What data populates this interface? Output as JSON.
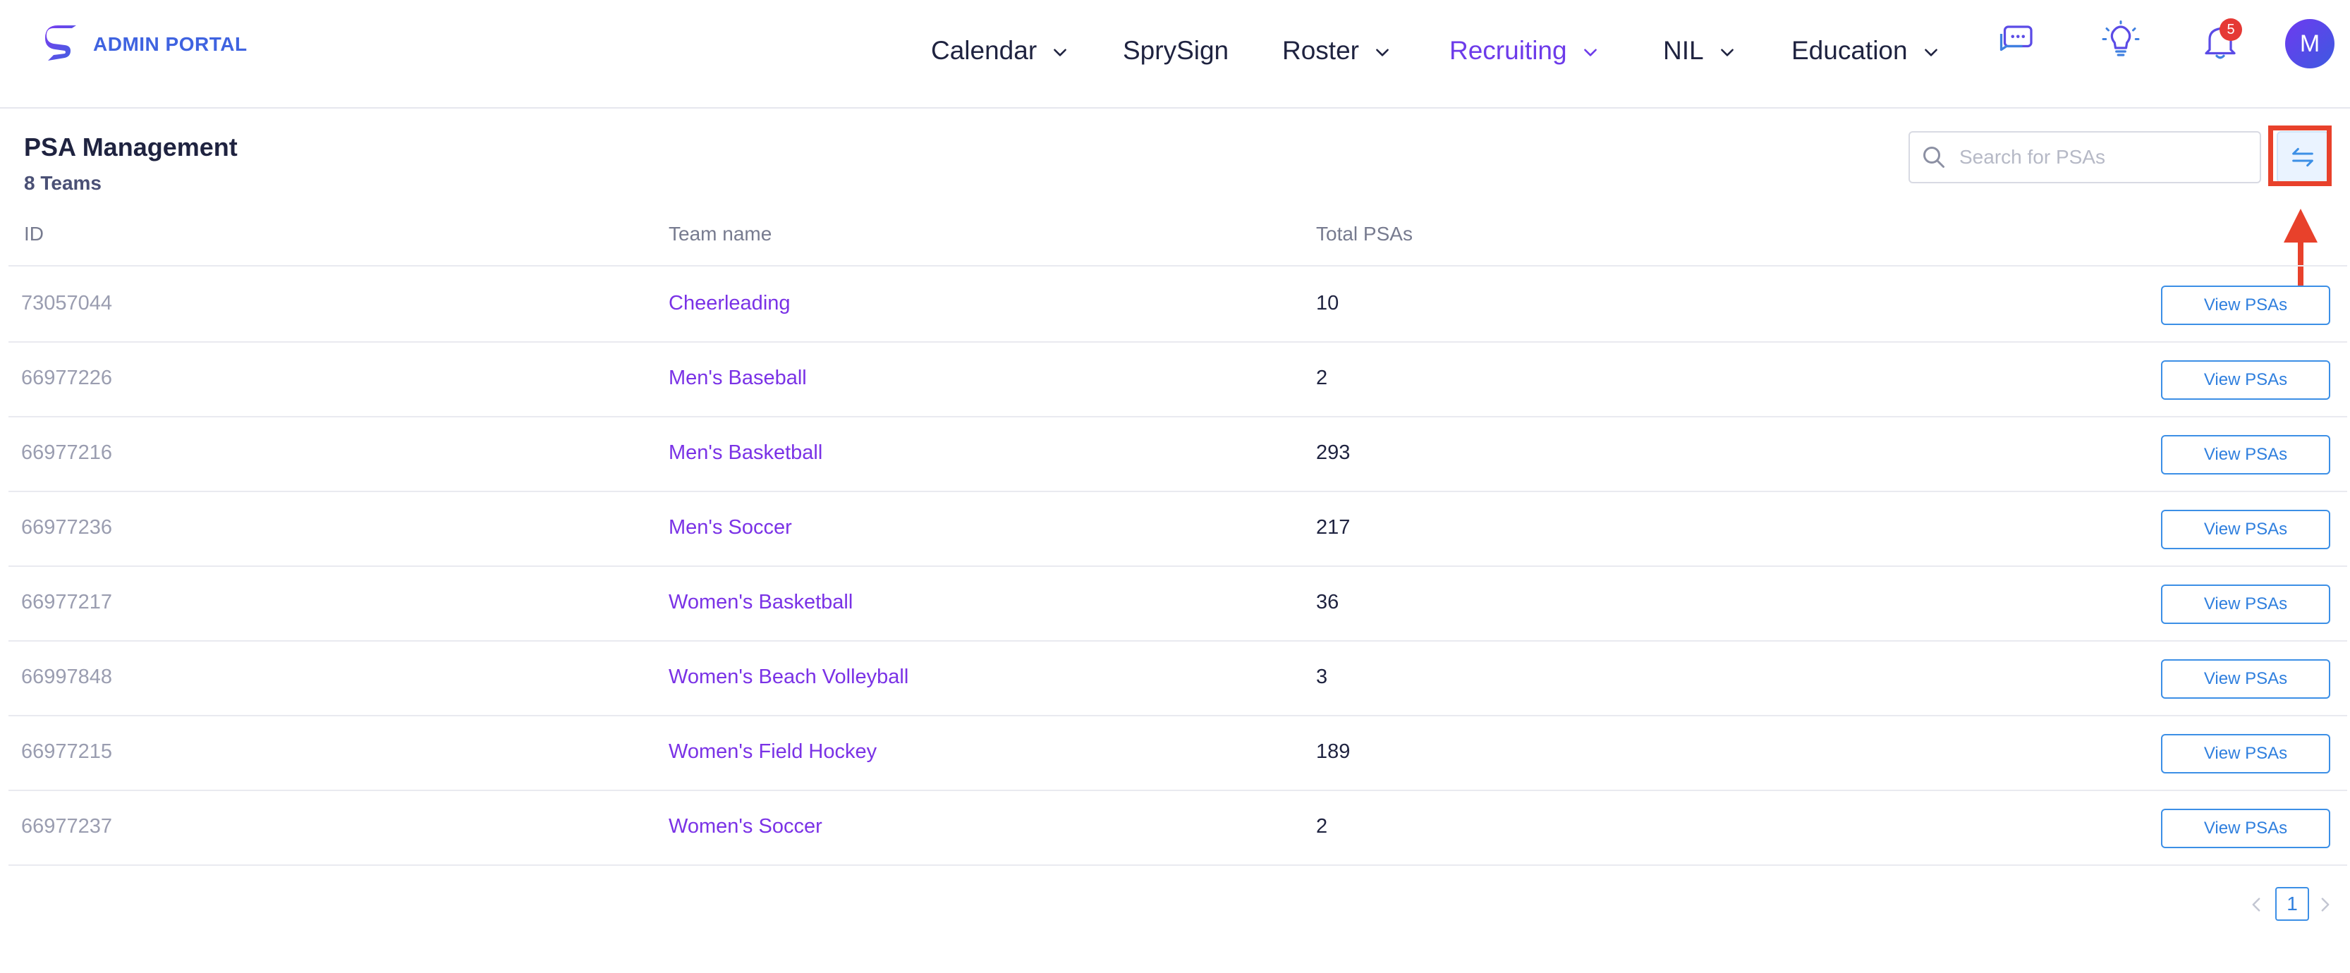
{
  "brand": {
    "name": "ADMIN PORTAL",
    "accent": "#3f63e0"
  },
  "nav": {
    "calendar": "Calendar",
    "sprysign": "SprySign",
    "roster": "Roster",
    "recruiting": "Recruiting",
    "nil": "NIL",
    "education": "Education",
    "active_color": "#6d3bea"
  },
  "header_icons": {
    "chat": "chat-icon",
    "bulb": "lightbulb-icon",
    "bell": "bell-icon",
    "notification_count": "5",
    "avatar_initial": "M"
  },
  "page": {
    "title": "PSA Management",
    "subtitle": "8 Teams"
  },
  "search": {
    "placeholder": "Search for PSAs",
    "value": ""
  },
  "sort_button": {
    "icon": "swap-arrows-icon",
    "highlight_color": "#e8412b"
  },
  "table": {
    "headers": {
      "id": "ID",
      "name": "Team name",
      "total": "Total PSAs"
    },
    "action_label": "View PSAs",
    "rows": [
      {
        "id": "73057044",
        "name": "Cheerleading",
        "total": "10"
      },
      {
        "id": "66977226",
        "name": "Men's Baseball",
        "total": "2"
      },
      {
        "id": "66977216",
        "name": "Men's Basketball",
        "total": "293"
      },
      {
        "id": "66977236",
        "name": "Men's Soccer",
        "total": "217"
      },
      {
        "id": "66977217",
        "name": "Women's Basketball",
        "total": "36"
      },
      {
        "id": "66997848",
        "name": "Women's Beach Volleyball",
        "total": "3"
      },
      {
        "id": "66977215",
        "name": "Women's Field Hockey",
        "total": "189"
      },
      {
        "id": "66977237",
        "name": "Women's Soccer",
        "total": "2"
      }
    ]
  },
  "pagination": {
    "current": "1"
  }
}
